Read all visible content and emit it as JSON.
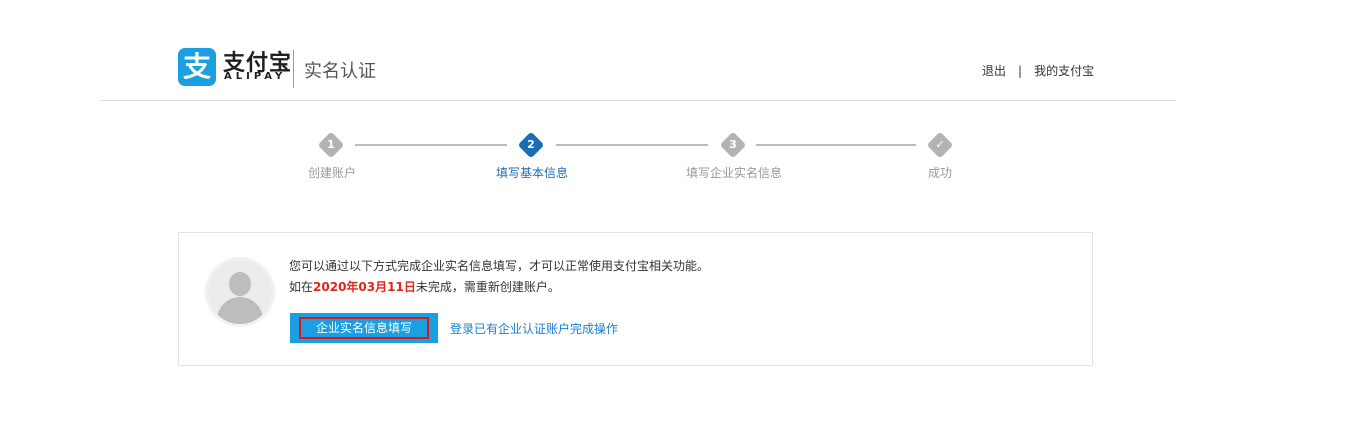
{
  "header": {
    "logo_mark": "支",
    "logo_text": "支付宝",
    "logo_sub": "ALIPAY",
    "page_title": "实名认证",
    "links": {
      "logout": "退出",
      "separator": "|",
      "my_alipay": "我的支付宝"
    }
  },
  "steps": [
    {
      "num": "1",
      "label": "创建账户",
      "state": "inactive"
    },
    {
      "num": "2",
      "label": "填写基本信息",
      "state": "active"
    },
    {
      "num": "3",
      "label": "填写企业实名信息",
      "state": "inactive"
    },
    {
      "num": "✓",
      "label": "成功",
      "state": "inactive"
    }
  ],
  "card": {
    "message_line1": "您可以通过以下方式完成企业实名信息填写，才可以正常使用支付宝相关功能。",
    "message_line2_prefix": "如在",
    "message_line2_date": "2020年03月11日",
    "message_line2_suffix": "未完成，需重新创建账户。",
    "primary_button": "企业实名信息填写",
    "login_link": "登录已有企业认证账户完成操作"
  },
  "colors": {
    "brand_blue": "#1a9fe2",
    "step_active": "#1c6cb5",
    "step_inactive": "#b3b3b3",
    "date_red": "#e0261b",
    "highlight_red": "#d91a1a"
  }
}
